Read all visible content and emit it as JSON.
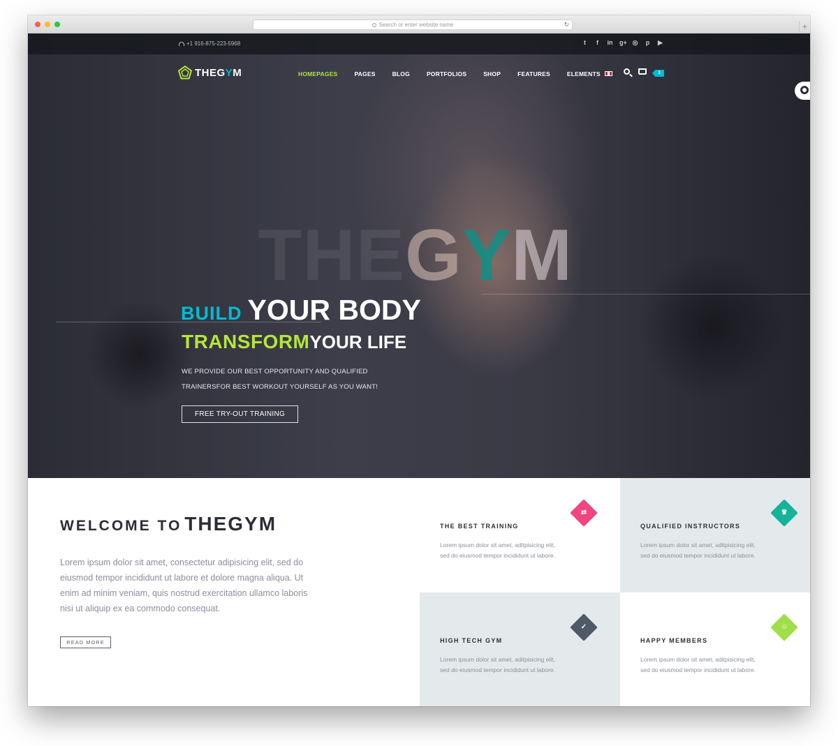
{
  "browser": {
    "url_placeholder": "Search or enter website name",
    "reload_icon": "↻",
    "new_tab_icon": "+"
  },
  "topbar": {
    "phone": "+1 916-875-223-5968",
    "socials": [
      {
        "name": "twitter",
        "glyph": "t"
      },
      {
        "name": "facebook",
        "glyph": "f"
      },
      {
        "name": "linkedin",
        "glyph": "in"
      },
      {
        "name": "google-plus",
        "glyph": "g+"
      },
      {
        "name": "instagram",
        "glyph": "◎"
      },
      {
        "name": "pinterest",
        "glyph": "p"
      },
      {
        "name": "youtube",
        "glyph": "▶"
      }
    ]
  },
  "header": {
    "logo_main": "THEG",
    "logo_accent": "Y",
    "logo_end": "M",
    "nav": [
      "HOMEPAGES",
      "PAGES",
      "BLOG",
      "PORTFOLIOS",
      "SHOP",
      "FEATURES",
      "ELEMENTS"
    ],
    "active_nav": "HOMEPAGES",
    "cart_count": "3"
  },
  "hero": {
    "bg_word_1": "THE",
    "bg_word_g": "G",
    "bg_word_y": "Y",
    "bg_word_m": "M",
    "line1_accent": "BUILD",
    "line1_main": "YOUR BODY",
    "line2_accent": "TRANSFORM",
    "line2_main": "YOUR LIFE",
    "description": "WE PROVIDE OUR BEST OPPORTUNITY AND QUALIFIED TRAINERSFOR BEST WORKOUT YOURSELF AS YOU WANT!",
    "cta": "FREE TRY-OUT TRAINING"
  },
  "welcome": {
    "title_small": "WELCOME TO",
    "title_big": "THEGYM",
    "text": "Lorem ipsum dolor sit amet, consectetur adipisicing elit, sed do eiusmod tempor incididunt ut labore et dolore magna aliqua. Ut enim ad minim veniam, quis nostrud exercitation ullamco laboris nisi ut aliquip ex ea commodo consequat.",
    "read_more": "READ MORE"
  },
  "features": [
    {
      "title": "THE BEST TRAINING",
      "text": "Lorem ipsum dolor sit amet, aditpisicing elit, sed do eiusmod tempor incididunt ut labore.",
      "icon": "arrows-icon",
      "glyph": "⇄",
      "color": "#f0457e",
      "bg": "#ffffff"
    },
    {
      "title": "QUALIFIED INSTRUCTORS",
      "text": "Lorem ipsum dolor sit amet, aditpisicing elit, sed do eiusmod tempor incididunt ut labore.",
      "icon": "trophy-icon",
      "glyph": "♛",
      "color": "#17b29a",
      "bg": "#e4eaec"
    },
    {
      "title": "HIGH TECH GYM",
      "text": "Lorem ipsum dolor sit amet, aditpisicing elit, sed do eiusmod tempor incididunt ut labore.",
      "icon": "thumbs-up-icon",
      "glyph": "✓",
      "color": "#4e5a68",
      "bg": "#e4eaec"
    },
    {
      "title": "HAPPY MEMBERS",
      "text": "Lorem ipsum dolor sit amet, aditpisicing elit, sed do eiusmod tempor incididunt ut labore.",
      "icon": "group-icon",
      "glyph": "☺",
      "color": "#9fe04a",
      "bg": "#ffffff"
    }
  ]
}
